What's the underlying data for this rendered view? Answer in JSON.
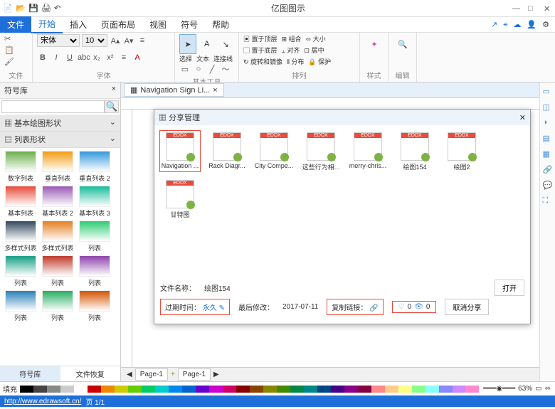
{
  "app": {
    "title": "亿图图示"
  },
  "window": {
    "min": "—",
    "max": "□",
    "close": "✕"
  },
  "menu": {
    "file": "文件",
    "start": "开始",
    "insert": "插入",
    "layout": "页面布局",
    "view": "视图",
    "symbol": "符号",
    "help": "帮助"
  },
  "ribbon": {
    "g_file": "文件",
    "g_font": "字体",
    "g_tools": "基本工具",
    "g_arrange": "排列",
    "g_style": "样式",
    "g_edit": "编辑",
    "font_name": "宋体",
    "font_size": "10",
    "cursor": "选择",
    "text": "文本",
    "connector": "连接线",
    "to_front": "置于顶层",
    "to_back": "置于底层",
    "rotate": "旋转和镜像",
    "group": "组合",
    "align": "对齐",
    "distribute": "分布",
    "size": "大小",
    "center": "居中",
    "protect": "保护"
  },
  "sidebar": {
    "title": "符号库",
    "section1": "基本绘图形状",
    "section2": "列表形状",
    "search": "",
    "search_ph": "",
    "shapes": [
      "数字列表",
      "垂直列表",
      "垂直列表 2",
      "基本列表",
      "基本列表 2",
      "基本列表 3",
      "多样式列表",
      "多样式列表",
      "列表",
      "列表",
      "列表",
      "列表",
      "列表",
      "列表",
      "列表"
    ],
    "tab1": "符号库",
    "tab2": "文件恢复"
  },
  "doctab": {
    "name": "Navigation Sign Li...",
    "close": "×"
  },
  "dialog": {
    "title": "分享管理",
    "close": "✕",
    "files": [
      "Navigation ...",
      "Rack Diagr...",
      "City Compe...",
      "这些行为相...",
      "merry-chris...",
      "绘图154",
      "绘图2",
      "甘特图"
    ],
    "badge": "EDDX",
    "fname_label": "文件名称：",
    "fname": "绘图154",
    "expire_label": "过期时间：",
    "expire": "永久",
    "modified_label": "最后修改：",
    "modified": "2017-07-11",
    "copy_label": "复制链接：",
    "likes": "0",
    "views": "0",
    "open": "打开",
    "cancel": "取消分享"
  },
  "pages": {
    "p1": "Page-1",
    "p2": "Page-1",
    "add": "+"
  },
  "footer": {
    "fill": "填充",
    "zoom": "63%",
    "slider": "━━━◉━━━"
  },
  "status": {
    "url": "http://www.edrawsoft.cn/",
    "page": "页 1/1"
  },
  "colors": [
    "#000",
    "#444",
    "#888",
    "#ccc",
    "#fff",
    "#c00",
    "#e80",
    "#cc0",
    "#6c0",
    "#0c6",
    "#0cc",
    "#08e",
    "#06c",
    "#60c",
    "#c0c",
    "#c06",
    "#800",
    "#840",
    "#880",
    "#480",
    "#084",
    "#088",
    "#048",
    "#408",
    "#808",
    "#804",
    "#f88",
    "#fc8",
    "#ff8",
    "#8f8",
    "#8ff",
    "#88f",
    "#c8f",
    "#f8c"
  ]
}
